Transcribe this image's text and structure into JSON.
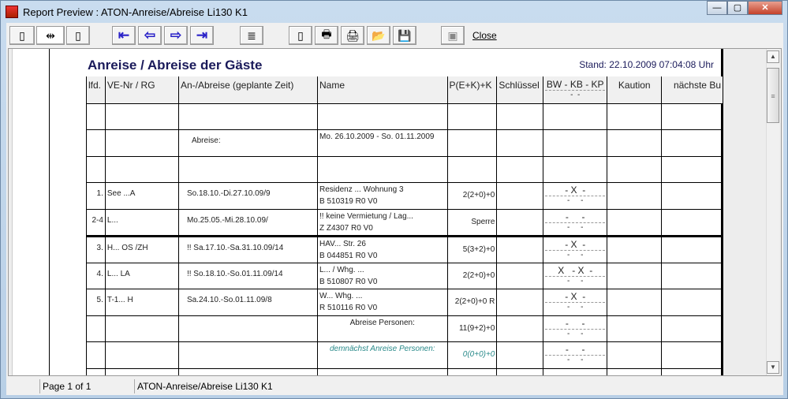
{
  "window": {
    "title": "Report Preview : ATON-Anreise/Abreise Li130 K1",
    "minimize": "—",
    "maximize": "▢",
    "close": "✕"
  },
  "toolbar": {
    "close_label": "Close",
    "icons": [
      "single-page",
      "page-width",
      "full-page",
      "first-page",
      "previous-page",
      "next-page",
      "last-page",
      "goto-page",
      "copy",
      "print-setup",
      "print",
      "open",
      "save",
      "exit"
    ]
  },
  "report": {
    "title": "Anreise / Abreise der Gäste",
    "stand": "Stand: 22.10.2009 07:04:08 Uhr",
    "headers": [
      "lfd.",
      "VE-Nr  / RG",
      "An-/Abreise (geplante Zeit)",
      "Name",
      "P(E+K)+K",
      "Schlüssel",
      "BW - KB - KP",
      "Kaution",
      "nächste Bu"
    ],
    "header_sub": "-  -",
    "rows": [
      {
        "lfd": "",
        "ve": "",
        "date": "",
        "name1": "",
        "name2": "",
        "p": "",
        "bw1": "",
        "bw2": ""
      },
      {
        "lfd": "",
        "ve": "",
        "date": "Abreise:",
        "name1": "Mo. 26.10.2009 - So. 01.11.2009",
        "name2": "",
        "p": "",
        "bw1": "",
        "bw2": ""
      },
      {
        "lfd": "",
        "ve": "",
        "date": "",
        "name1": "",
        "name2": "",
        "p": "",
        "bw1": "",
        "bw2": ""
      },
      {
        "lfd": "1.",
        "ve": "See ...A",
        "date": "So.18.10.-Di.27.10.09/9",
        "name1": "Residenz ... Wohnung 3",
        "name2": "B 510319     R0  V0",
        "p": "2(2+0)+0",
        "bw1": "- X  -",
        "bw2": "-     -"
      },
      {
        "lfd": "2-4",
        "ve": "L...",
        "date": "Mo.25.05.-Mi.28.10.09/",
        "name1": "!! keine Vermietung / Lag...",
        "name2": "Z Z4307      R0  V0",
        "p": "Sperre",
        "bw1": "-     -",
        "bw2": "-     -"
      },
      {
        "lfd": "3.",
        "ve": "H... OS /ZH",
        "date": "!! Sa.17.10.-Sa.31.10.09/14",
        "name1": "HAV... Str. 26",
        "name2": "B 044851     R0  V0",
        "p": "5(3+2)+0",
        "bw1": "- X  -",
        "bw2": "-     -"
      },
      {
        "lfd": "4.",
        "ve": "L... LA",
        "date": "!! So.18.10.-So.01.11.09/14",
        "name1": "L... / Whg. ...",
        "name2": "B 510807     R0  V0",
        "p": "2(2+0)+0",
        "bw1": "X   - X  -",
        "bw2": "-     -"
      },
      {
        "lfd": "5.",
        "ve": "T-1... H",
        "date": "Sa.24.10.-So.01.11.09/8",
        "name1": "W...   Whg. ...",
        "name2": "R 510116     R0  V0",
        "p": "2(2+0)+0 R",
        "bw1": "- X  -",
        "bw2": "-     -"
      },
      {
        "lfd": "",
        "ve": "",
        "date": "",
        "name1": "Abreise Personen:",
        "name2": "",
        "p": "11(9+2)+0",
        "bw1": "-     -",
        "bw2": "-     -"
      },
      {
        "lfd": "",
        "ve": "",
        "date": "",
        "name1": "demnächst Anreise Personen:",
        "name2": "",
        "p": "0(0+0)+0",
        "bw1": "-     -",
        "bw2": "-     -"
      },
      {
        "lfd": "",
        "ve": "",
        "date": "",
        "name1": "",
        "name2": "",
        "p": "",
        "bw1": "",
        "bw2": ""
      }
    ]
  },
  "statusbar": {
    "page": "Page 1 of 1",
    "report_name": "ATON-Anreise/Abreise Li130 K1"
  }
}
